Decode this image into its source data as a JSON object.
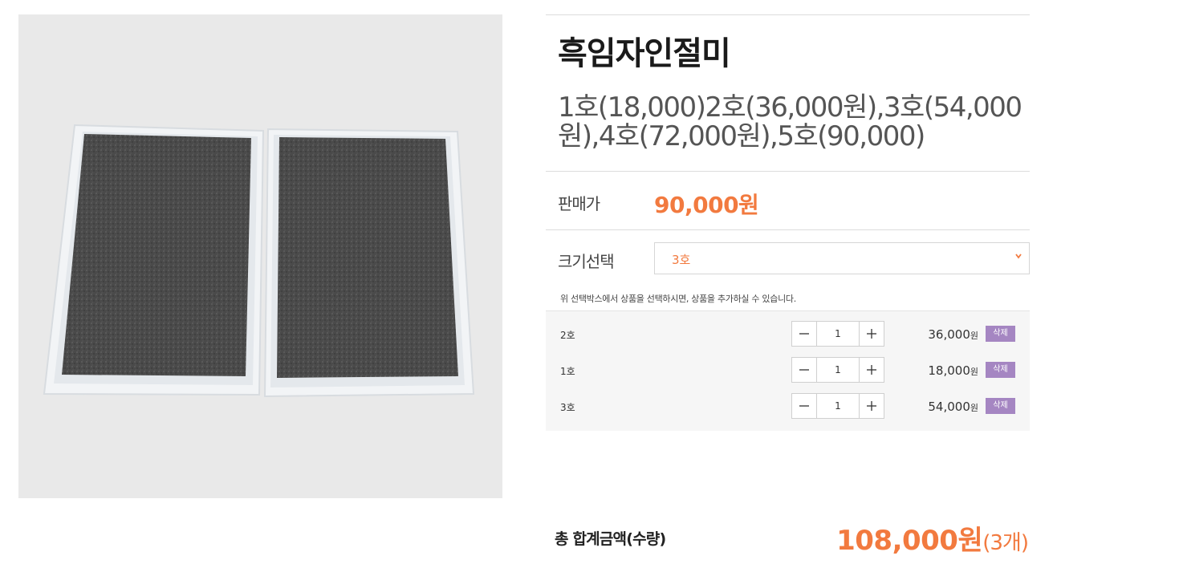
{
  "product": {
    "title": "흑임자인절미",
    "subtitle": "1호(18,000)2호(36,000원),3호(54,000원),4호(72,000원),5호(90,000)",
    "price_label": "판매가",
    "price": "90,000원"
  },
  "size_select": {
    "label": "크기선택",
    "selected": "3호",
    "notice": "위 선택박스에서 상품을 선택하시면, 상품을 추가하실 수 있습니다."
  },
  "options": [
    {
      "name": "2호",
      "qty": "1",
      "price": "36,000",
      "unit": "원",
      "delete_label": "삭제"
    },
    {
      "name": "1호",
      "qty": "1",
      "price": "18,000",
      "unit": "원",
      "delete_label": "삭제"
    },
    {
      "name": "3호",
      "qty": "1",
      "price": "54,000",
      "unit": "원",
      "delete_label": "삭제"
    }
  ],
  "total": {
    "label": "총 합계금액(수량)",
    "amount": "108,000원",
    "count": "(3개)"
  },
  "colors": {
    "accent": "#f27a3f",
    "delete_button": "#a586c2",
    "panel_bg": "#f6f6f6"
  },
  "icons": {
    "minus": "minus-icon",
    "plus": "plus-icon",
    "dropdown": "chevron-down-icon"
  }
}
